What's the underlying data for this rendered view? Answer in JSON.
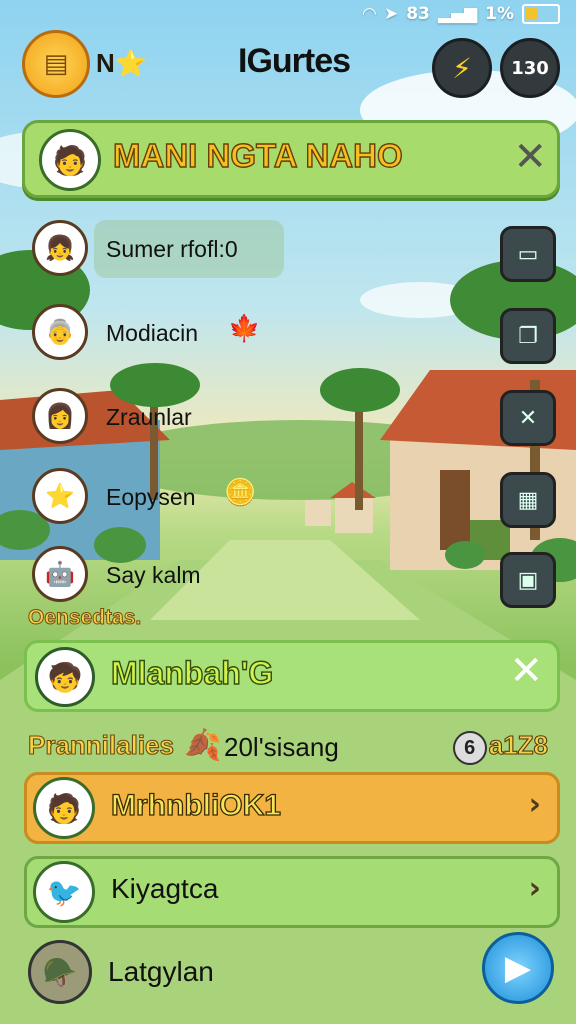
{
  "status_bar": {
    "time_text": "83",
    "battery_text": "1%"
  },
  "top_bar": {
    "player_label": "N⭐",
    "title": "IGurtes",
    "level_badge": "130"
  },
  "banner": {
    "title": "MANI NGTA NAHO",
    "close_label": "✕"
  },
  "side_list": {
    "items": [
      {
        "label": "Sumer rfofl:0",
        "icon": "girl-avatar"
      },
      {
        "label": "Modiacin",
        "icon": "grandma-avatar",
        "extra": "🍁"
      },
      {
        "label": "Zraunlar",
        "icon": "woman-avatar"
      },
      {
        "label": "Eopysen",
        "icon": "star-avatar",
        "extra": "🪙"
      },
      {
        "label": "Say kalm",
        "icon": "robot-avatar"
      }
    ]
  },
  "right_tools": [
    "tablet-icon",
    "folder-icon",
    "compass-icon",
    "shop-icon",
    "chest-icon"
  ],
  "section_label": "Oensedtas.",
  "player_card": {
    "name": "Mlanbah'G",
    "close_label": "✕"
  },
  "stats": {
    "label_a": "Prannilalies",
    "value_b": "20l'sisang",
    "coin_number": "6",
    "value_c": "a1Z8"
  },
  "menu": {
    "row1": "MrhnbliOK1",
    "row2": "Kiyagtca",
    "row3": "Latgylan"
  },
  "colors": {
    "accent_orange": "#f2b342",
    "banner_green": "#a7dc6c",
    "play_blue": "#1e8fd8"
  }
}
